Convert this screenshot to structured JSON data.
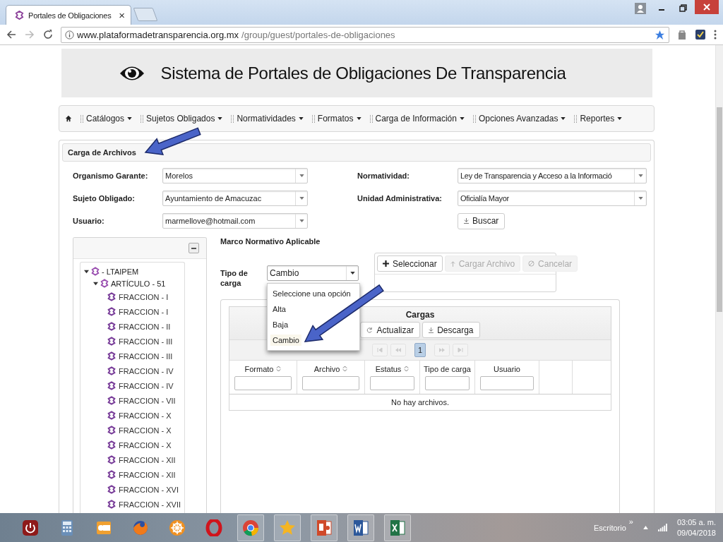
{
  "browser": {
    "tab": {
      "title": "Portales de Obligaciones",
      "close": "×"
    },
    "url": {
      "host": "www.plataformadetransparencia.org.mx",
      "path": "/group/guest/portales-de-obligaciones"
    }
  },
  "header": {
    "title": "Sistema de Portales de Obligaciones De Transparencia"
  },
  "nav": {
    "items": [
      {
        "label": "Catálogos"
      },
      {
        "label": "Sujetos Obligados"
      },
      {
        "label": "Normatividades"
      },
      {
        "label": "Formatos"
      },
      {
        "label": "Carga de Información"
      },
      {
        "label": "Opciones Avanzadas"
      },
      {
        "label": "Reportes"
      }
    ]
  },
  "panel": {
    "title": "Carga de Archivos",
    "fields": [
      {
        "label": "Organismo Garante:",
        "value": "Morelos"
      },
      {
        "label": "Normatividad:",
        "value": "Ley de Transparencia y Acceso a la Informació"
      },
      {
        "label": "Sujeto Obligado:",
        "value": "Ayuntamiento de Amacuzac"
      },
      {
        "label": "Unidad Administrativa:",
        "value": "Oficialía Mayor"
      },
      {
        "label": "Usuario:",
        "value": "marmellove@hotmail.com"
      }
    ],
    "search_button": "Buscar"
  },
  "tree": [
    {
      "label": "- LTAIPEM",
      "expanded": true,
      "children": [
        {
          "label": "ARTÍCULO - 51",
          "expanded": true,
          "children": [
            {
              "label": "FRACCION - I"
            },
            {
              "label": "FRACCION - I"
            },
            {
              "label": "FRACCION - II"
            },
            {
              "label": "FRACCION - III"
            },
            {
              "label": "FRACCION - III"
            },
            {
              "label": "FRACCION - IV"
            },
            {
              "label": "FRACCION - IV"
            },
            {
              "label": "FRACCION - VII"
            },
            {
              "label": "FRACCION - X"
            },
            {
              "label": "FRACCION - X"
            },
            {
              "label": "FRACCION - X"
            },
            {
              "label": "FRACCION - XII"
            },
            {
              "label": "FRACCION - XII"
            },
            {
              "label": "FRACCION - XVI"
            },
            {
              "label": "FRACCION - XVII"
            }
          ]
        }
      ]
    }
  ],
  "marco": {
    "title": "Marco Normativo Aplicable",
    "tipo_label": "Tipo de carga",
    "tipo_value": "Cambio",
    "options": [
      {
        "label": "Seleccione una opción",
        "selected": false
      },
      {
        "label": "Alta",
        "selected": false
      },
      {
        "label": "Baja",
        "selected": false
      },
      {
        "label": "Cambio",
        "selected": true
      }
    ]
  },
  "upload_buttons": [
    {
      "kind": "plus",
      "label": "Seleccionar",
      "disabled": false
    },
    {
      "kind": "upload",
      "label": "Cargar Archivo",
      "disabled": true
    },
    {
      "kind": "cancel",
      "label": "Cancelar",
      "disabled": true
    }
  ],
  "cargas": {
    "title": "Cargas",
    "buttons": [
      {
        "kind": "refresh",
        "label": "Actualizar"
      },
      {
        "kind": "download",
        "label": "Descarga"
      }
    ],
    "pages": [
      {
        "label": "1",
        "selected": true
      }
    ],
    "columns": [
      {
        "label": "Formato",
        "sortable": true
      },
      {
        "label": "Archivo",
        "sortable": true
      },
      {
        "label": "Estatus",
        "sortable": true
      },
      {
        "label": "Tipo de carga",
        "sortable": false
      },
      {
        "label": "Usuario",
        "sortable": false
      }
    ],
    "empty": "No hay archivos."
  },
  "taskbar": {
    "apps": [
      {
        "kind": "power",
        "running": false
      },
      {
        "kind": "calculator",
        "running": false
      },
      {
        "kind": "mail",
        "running": false
      },
      {
        "kind": "firefox",
        "running": false
      },
      {
        "kind": "wheel",
        "running": false
      },
      {
        "kind": "opera",
        "running": false
      },
      {
        "kind": "chrome",
        "running": true
      },
      {
        "kind": "star",
        "running": true
      },
      {
        "kind": "slides",
        "running": true
      },
      {
        "kind": "word",
        "running": true
      },
      {
        "kind": "sheet",
        "running": true
      }
    ],
    "desktop": "Escritorio",
    "chevron": "»",
    "time": "03:05 a. m.",
    "date": "09/04/2018"
  }
}
